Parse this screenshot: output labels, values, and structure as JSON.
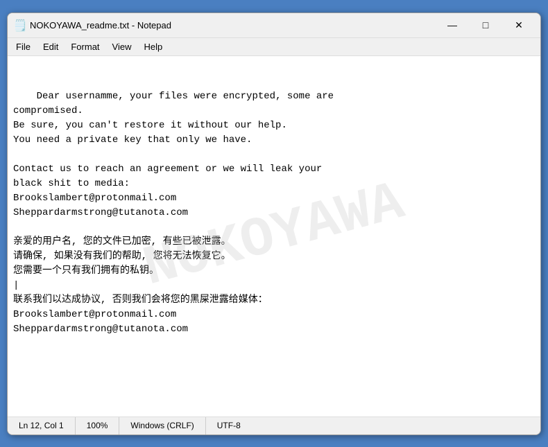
{
  "window": {
    "title": "NOKOYAWA_readme.txt - Notepad",
    "icon": "📄"
  },
  "title_bar": {
    "minimize_label": "—",
    "maximize_label": "□",
    "close_label": "✕"
  },
  "menu": {
    "items": [
      "File",
      "Edit",
      "Format",
      "View",
      "Help"
    ]
  },
  "content": {
    "text": "Dear usernamme, your files were encrypted, some are\ncompromised.\nBe sure, you can't restore it without our help.\nYou need a private key that only we have.\n\nContact us to reach an agreement or we will leak your\nblack shit to media:\nBrookslambert@protonmail.com\nSheppardarmstrong@tutanota.com\n\n亲爱的用户名, 您的文件已加密, 有些已被泄露。\n请确保, 如果没有我们的帮助, 您将无法恢复它。\n您需要一个只有我们拥有的私钥。\n|\n联系我们以达成协议, 否则我们会将您的黑屎泄露给媒体：\nBrookslambert@protonmail.com\nSheppardarmstrong@tutanota.com"
  },
  "status_bar": {
    "line_col": "Ln 12, Col 1",
    "zoom": "100%",
    "line_ending": "Windows (CRLF)",
    "encoding": "UTF-8"
  }
}
